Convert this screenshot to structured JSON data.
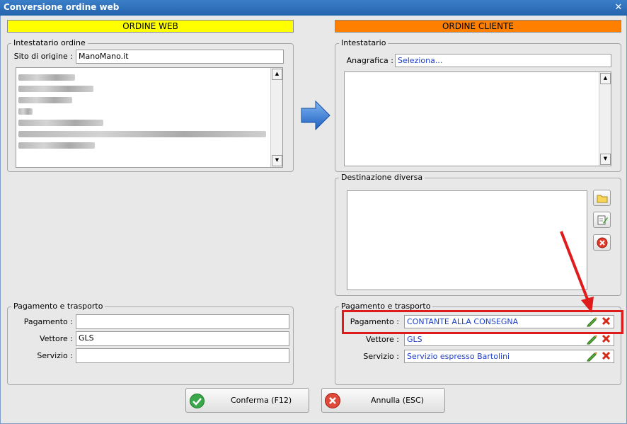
{
  "window": {
    "title": "Conversione ordine web"
  },
  "web": {
    "banner": "ORDINE WEB",
    "intestatario_legend": "Intestatario ordine",
    "sito_label": "Sito di origine :",
    "sito_value": "ManoMano.it",
    "pagamento_legend": "Pagamento e trasporto",
    "pagamento_label": "Pagamento :",
    "pagamento_value": "",
    "vettore_label": "Vettore :",
    "vettore_value": "GLS",
    "servizio_label": "Servizio :",
    "servizio_value": ""
  },
  "cliente": {
    "banner": "ORDINE CLIENTE",
    "intestatario_legend": "Intestatario",
    "anagrafica_label": "Anagrafica :",
    "anagrafica_value": "Seleziona...",
    "destinazione_legend": "Destinazione diversa",
    "pagamento_legend": "Pagamento e trasporto",
    "pagamento_label": "Pagamento :",
    "pagamento_value": "CONTANTE ALLA CONSEGNA",
    "vettore_label": "Vettore :",
    "vettore_value": "GLS",
    "servizio_label": "Servizio :",
    "servizio_value": "Servizio espresso Bartolini"
  },
  "buttons": {
    "confirm": "Conferma (F12)",
    "cancel": "Annulla (ESC)"
  },
  "colors": {
    "web_banner": "#ffff00",
    "cliente_banner": "#ff8000",
    "highlight": "#e01b1b",
    "value_text": "#1d3fc8"
  },
  "icons": [
    "close-icon",
    "arrow-right-icon",
    "folder-icon",
    "edit-icon",
    "delete-icon",
    "pencil-icon",
    "x-icon",
    "check-icon",
    "cancel-icon",
    "red-arrow-annotation"
  ]
}
